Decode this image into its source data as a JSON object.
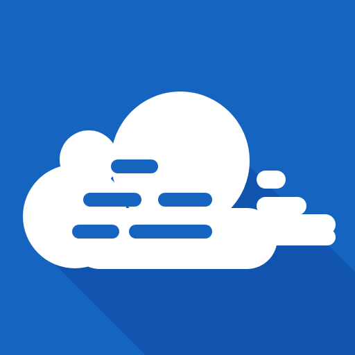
{
  "app_icon": {
    "icon": "cloud-icon",
    "colors": {
      "background": "#1565c0",
      "shadow": "#0d47a1",
      "cloud": "#ffffff",
      "stripe": "#1565c0"
    }
  }
}
